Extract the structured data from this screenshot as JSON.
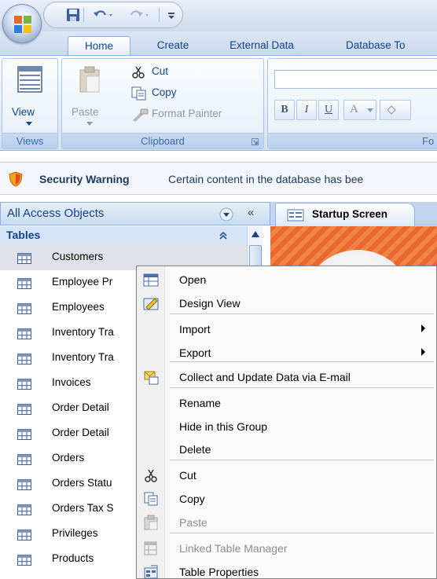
{
  "qat": {
    "save_icon": "save-icon",
    "undo_icon": "undo-icon",
    "redo_icon": "redo-icon",
    "customize_icon": "customize-qat-icon"
  },
  "ribbon_tabs": [
    "Home",
    "Create",
    "External Data",
    "Database To"
  ],
  "ribbon": {
    "views_group": {
      "view_label": "View",
      "group_label": "Views"
    },
    "clipboard_group": {
      "paste_label": "Paste",
      "cut_label": "Cut",
      "copy_label": "Copy",
      "format_painter_label": "Format Painter",
      "group_label": "Clipboard"
    },
    "font_group": {
      "bold": "B",
      "italic": "I",
      "underline": "U",
      "font_color": "A",
      "group_label": "Fo"
    }
  },
  "security": {
    "title": "Security Warning",
    "message": "Certain content in the database has bee"
  },
  "nav": {
    "title": "All Access Objects",
    "collapse": "«",
    "group_title": "Tables",
    "items": [
      "Customers",
      "Employee Pr",
      "Employees",
      "Inventory Tra",
      "Inventory Tra",
      "Invoices",
      "Order Detail",
      "Order Detail",
      "Orders",
      "Orders Statu",
      "Orders Tax S",
      "Privileges",
      "Products"
    ]
  },
  "document": {
    "tab_label": "Startup Screen"
  },
  "context_menu": {
    "items": [
      {
        "label": "Open",
        "icon": "open-icon",
        "disabled": false,
        "submenu": false
      },
      {
        "label": "Design View",
        "icon": "design-view-icon",
        "disabled": false,
        "submenu": false
      },
      {
        "label": "Import",
        "icon": "",
        "disabled": false,
        "submenu": true
      },
      {
        "label": "Export",
        "icon": "",
        "disabled": false,
        "submenu": true
      },
      {
        "label": "Collect and Update Data via E-mail",
        "icon": "collect-data-icon",
        "disabled": false,
        "submenu": false
      },
      {
        "label": "Rename",
        "icon": "",
        "disabled": false,
        "submenu": false
      },
      {
        "label": "Hide in this Group",
        "icon": "",
        "disabled": false,
        "submenu": false
      },
      {
        "label": "Delete",
        "icon": "",
        "disabled": false,
        "submenu": false
      },
      {
        "label": "Cut",
        "icon": "scissors-icon",
        "disabled": false,
        "submenu": false
      },
      {
        "label": "Copy",
        "icon": "copy-icon",
        "disabled": false,
        "submenu": false
      },
      {
        "label": "Paste",
        "icon": "paste-icon",
        "disabled": true,
        "submenu": false
      },
      {
        "label": "Linked Table Manager",
        "icon": "linked-table-manager-icon",
        "disabled": true,
        "submenu": false
      },
      {
        "label": "Table Properties",
        "icon": "table-properties-icon",
        "disabled": false,
        "submenu": false
      }
    ]
  }
}
